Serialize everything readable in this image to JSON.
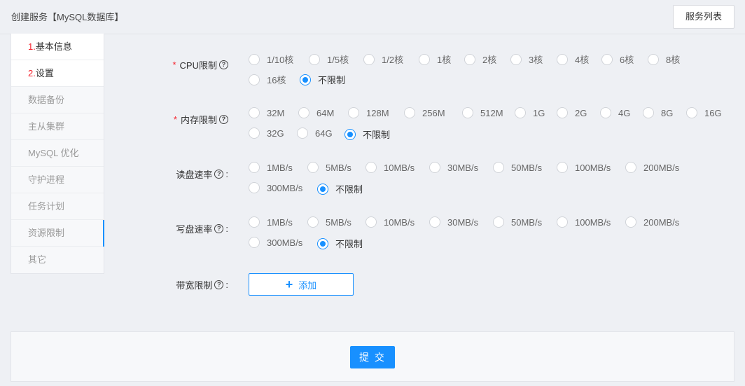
{
  "header": {
    "title": "创建服务【MySQL数据库】",
    "list_button": "服务列表"
  },
  "steps": [
    {
      "num": "1.",
      "label": "基本信息",
      "state": "done"
    },
    {
      "num": "2.",
      "label": "设置",
      "state": "done"
    },
    {
      "num": "",
      "label": "数据备份",
      "state": "pending"
    },
    {
      "num": "",
      "label": "主从集群",
      "state": "pending"
    },
    {
      "num": "",
      "label": "MySQL 优化",
      "state": "pending"
    },
    {
      "num": "",
      "label": "守护进程",
      "state": "pending"
    },
    {
      "num": "",
      "label": "任务计划",
      "state": "pending"
    },
    {
      "num": "",
      "label": "资源限制",
      "state": "active"
    },
    {
      "num": "",
      "label": "其它",
      "state": "pending"
    }
  ],
  "form": {
    "cpu": {
      "label": "CPU限制",
      "required": true,
      "options": [
        "1/10核",
        "1/5核",
        "1/2核",
        "1核",
        "2核",
        "3核",
        "4核",
        "6核",
        "8核",
        "16核",
        "不限制"
      ],
      "selected": "不限制"
    },
    "memory": {
      "label": "内存限制",
      "required": true,
      "options": [
        "32M",
        "64M",
        "128M",
        "256M",
        "512M",
        "1G",
        "2G",
        "4G",
        "8G",
        "16G",
        "32G",
        "64G",
        "不限制"
      ],
      "selected": "不限制"
    },
    "read_rate": {
      "label": "读盘速率",
      "required": false,
      "options": [
        "1MB/s",
        "5MB/s",
        "10MB/s",
        "30MB/s",
        "50MB/s",
        "100MB/s",
        "200MB/s",
        "300MB/s",
        "不限制"
      ],
      "selected": "不限制"
    },
    "write_rate": {
      "label": "写盘速率",
      "required": false,
      "options": [
        "1MB/s",
        "5MB/s",
        "10MB/s",
        "30MB/s",
        "50MB/s",
        "100MB/s",
        "200MB/s",
        "300MB/s",
        "不限制"
      ],
      "selected": "不限制"
    },
    "bandwidth": {
      "label": "带宽限制",
      "add_button": "添加"
    },
    "help_glyph": "?",
    "colon": ":",
    "required_mark": "*"
  },
  "footer": {
    "submit_label": "提 交"
  },
  "colors": {
    "accent": "#1890ff",
    "required": "#f5222d"
  }
}
